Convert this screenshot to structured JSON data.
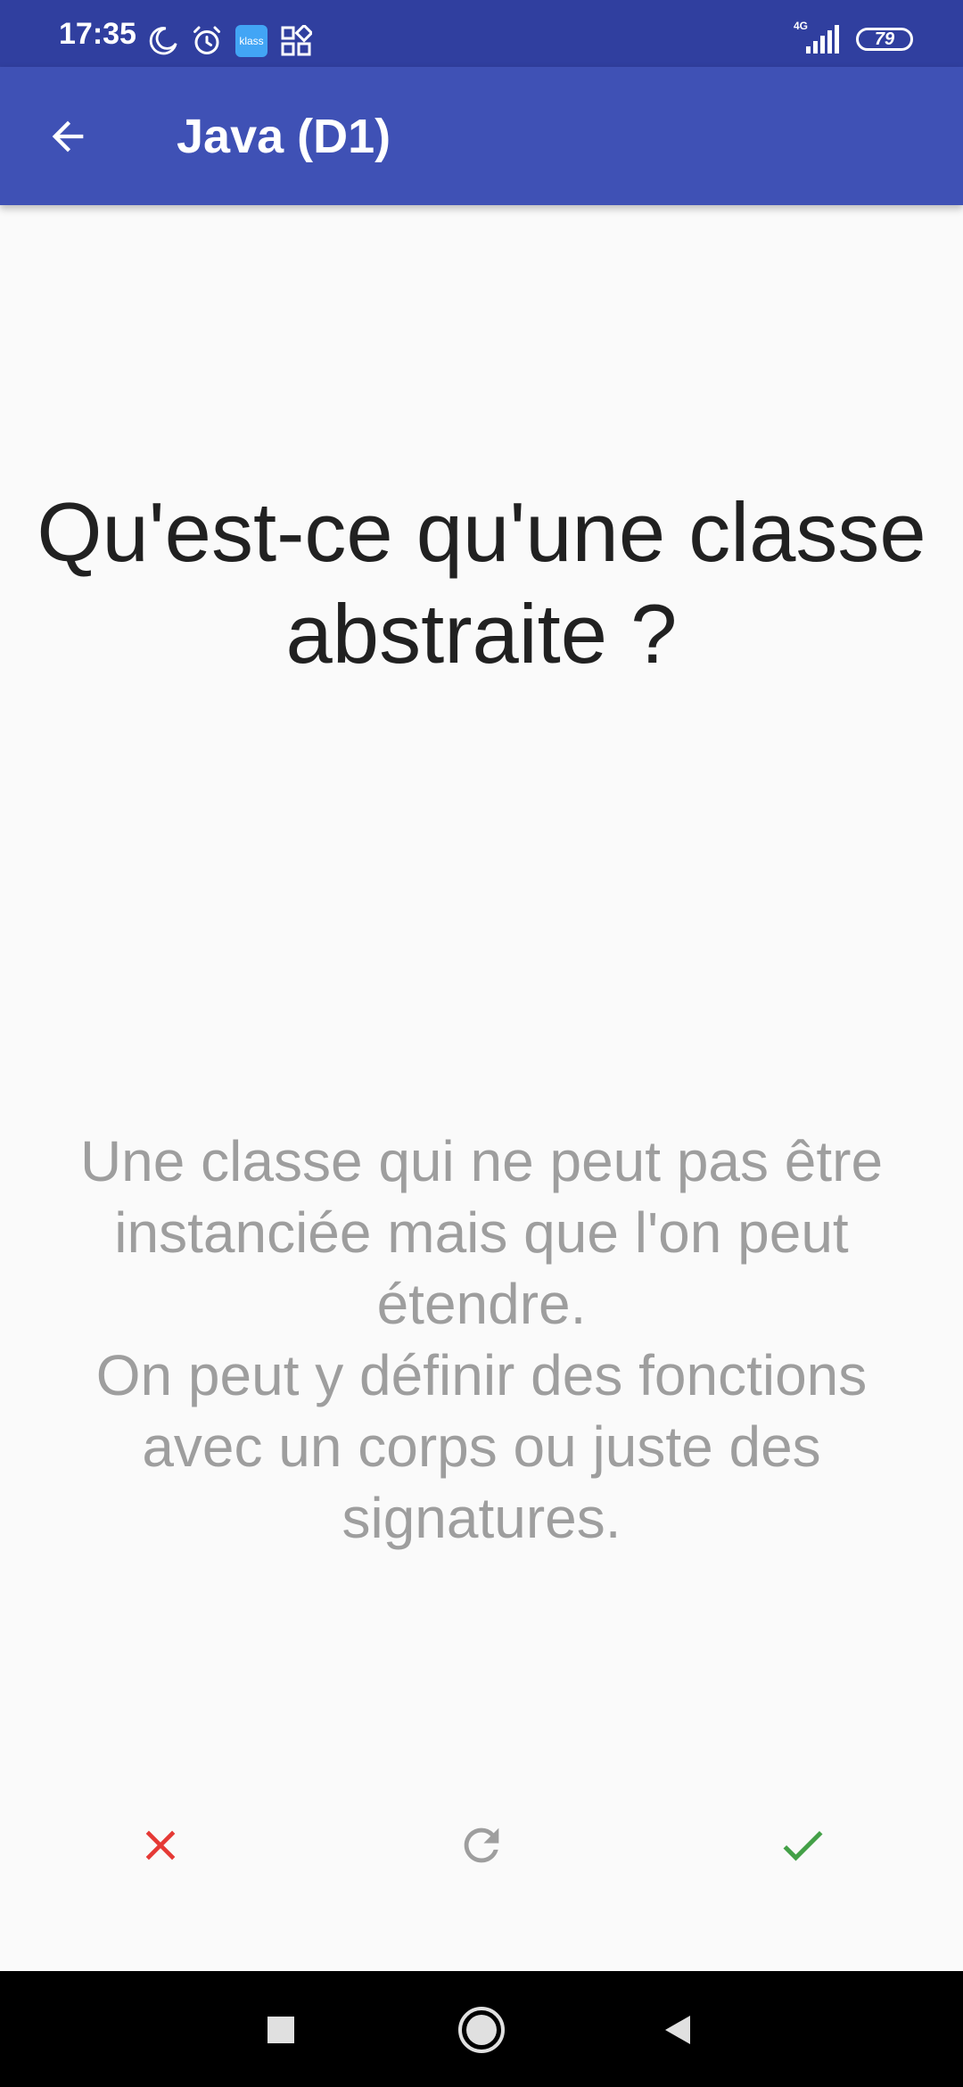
{
  "status_bar": {
    "time": "17:35",
    "icons": [
      "moon-icon",
      "alarm-icon",
      "klass-app-icon",
      "app-grid-icon"
    ],
    "klass_label": "klass",
    "network": "4G",
    "battery": "79"
  },
  "app_bar": {
    "title": "Java (D1)",
    "back_icon": "arrow-back-icon",
    "color": "#3f51b5"
  },
  "card": {
    "question": "Qu'est-ce qu'une classe abstraite ?",
    "answer": "Une classe qui ne peut pas être instanciée mais que l'on peut étendre.\nOn peut y définir des fonctions avec un corps ou juste des signatures."
  },
  "actions": {
    "wrong_icon": "close-icon",
    "wrong_color": "#e53935",
    "retry_icon": "refresh-icon",
    "retry_color": "#9e9e9e",
    "correct_icon": "check-icon",
    "correct_color": "#43a047"
  },
  "nav": {
    "recents_icon": "square-icon",
    "home_icon": "circle-icon",
    "back_icon": "triangle-back-icon"
  }
}
